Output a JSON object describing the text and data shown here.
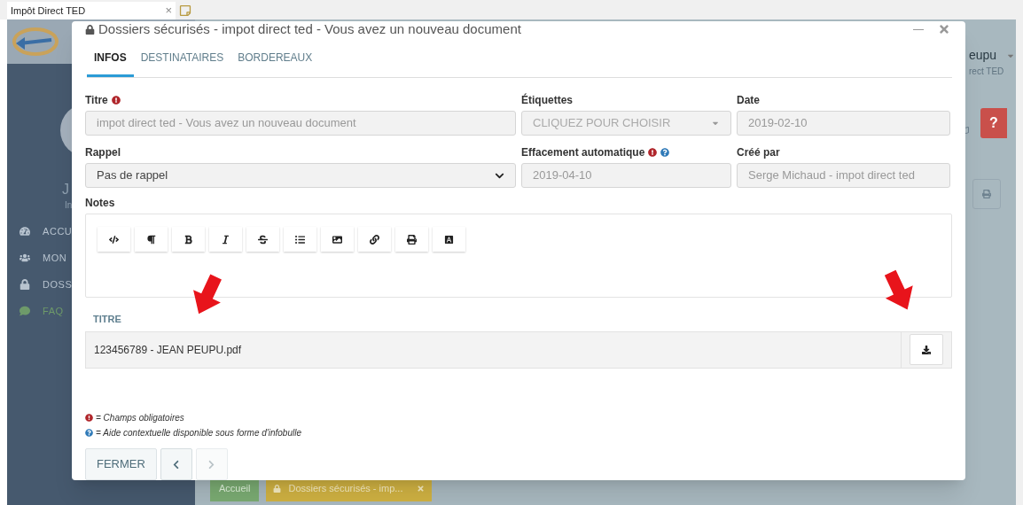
{
  "browser_tab": {
    "title": "Impôt Direct TED",
    "close": "×"
  },
  "sidebar": {
    "user_initial": "J",
    "user_sub": "In",
    "items": [
      {
        "kind": "dashboard",
        "label": "ACCU",
        "selected": false
      },
      {
        "kind": "users",
        "label": "MON",
        "selected": false
      },
      {
        "kind": "lock",
        "label": "DOSS",
        "selected": false
      },
      {
        "kind": "chat",
        "label": "FAQ",
        "selected": true
      }
    ]
  },
  "header": {
    "user_name": "eupu",
    "user_org": "rect TED",
    "help": "?"
  },
  "footer_tabs": [
    {
      "kind": "home",
      "label": "Accueil"
    },
    {
      "kind": "document",
      "label": "Dossiers sécurisés - imp..."
    }
  ],
  "modal": {
    "title": "Dossiers sécurisés - impot direct ted - Vous avez un nouveau document",
    "tabs": [
      {
        "label": "INFOS",
        "selected": true
      },
      {
        "label": "DESTINATAIRES",
        "selected": false
      },
      {
        "label": "BORDEREAUX",
        "selected": false
      }
    ],
    "fields": [
      {
        "kind": "text",
        "label": "Titre",
        "required": true,
        "help": false,
        "value": "impot direct ted - Vous avez un nouveau document"
      },
      {
        "kind": "tags",
        "label": "Étiquettes",
        "required": false,
        "help": false,
        "placeholder": "CLIQUEZ POUR CHOISIR"
      },
      {
        "kind": "text",
        "label": "Date",
        "required": false,
        "help": false,
        "value": "2019-02-10"
      },
      {
        "kind": "select",
        "label": "Rappel",
        "required": false,
        "help": false,
        "value": "Pas de rappel"
      },
      {
        "kind": "text",
        "label": "Effacement automatique",
        "required": true,
        "help": true,
        "value": "2019-04-10"
      },
      {
        "kind": "text",
        "label": "Créé par",
        "required": false,
        "help": false,
        "value": "Serge Michaud - impot direct ted"
      }
    ],
    "notes_label": "Notes",
    "files": {
      "column": "TITRE",
      "rows": [
        {
          "name": "123456789 - JEAN PEUPU.pdf"
        }
      ]
    },
    "legend": [
      {
        "kind": "required",
        "text": "= Champs obligatoires"
      },
      {
        "kind": "help",
        "text": "= Aide contextuelle disponible sous forme d'infobulle"
      }
    ],
    "close_button": "FERMER",
    "nav": [
      {
        "kind": "prev",
        "disabled": false
      },
      {
        "kind": "next",
        "disabled": true
      }
    ]
  }
}
